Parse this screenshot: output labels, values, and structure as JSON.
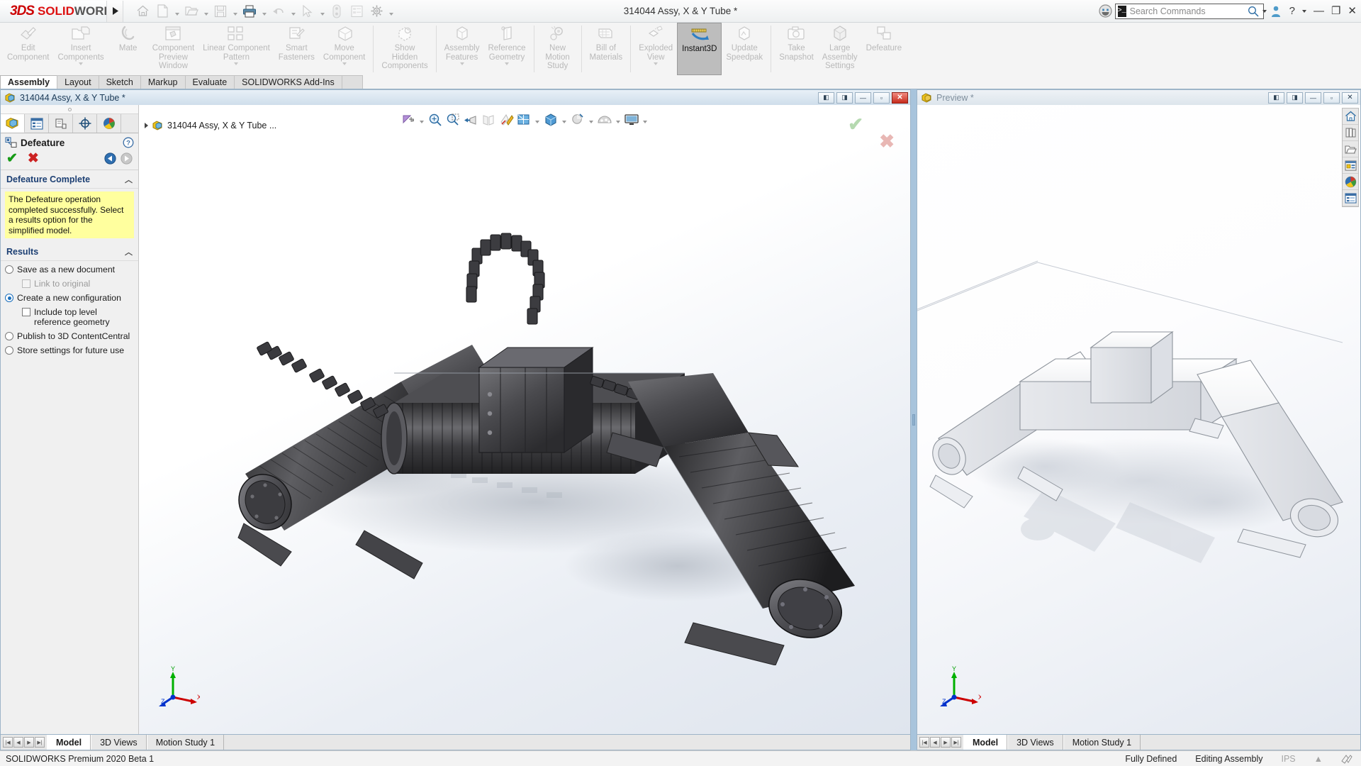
{
  "app": {
    "brand_ds": "3DS",
    "brand_solid": "SOLID",
    "brand_works": "WORKS",
    "document_title": "314044 Assy, X & Y Tube *",
    "accent_color": "#cc0000",
    "selected_tool_color": "#bdbdbd"
  },
  "quick_access": [
    {
      "name": "home-icon",
      "label": "Home"
    },
    {
      "name": "new-document-icon",
      "label": "New",
      "dropdown": true
    },
    {
      "name": "open-folder-icon",
      "label": "Open",
      "dropdown": true
    },
    {
      "name": "save-icon",
      "label": "Save",
      "dropdown": true
    },
    {
      "name": "print-icon",
      "label": "Print",
      "dropdown": true,
      "active": true
    },
    {
      "name": "undo-icon",
      "label": "Undo",
      "dropdown": true
    },
    {
      "name": "select-cursor-icon",
      "label": "Select",
      "dropdown": true
    },
    {
      "name": "rebuild-icon",
      "label": "Rebuild"
    },
    {
      "name": "file-properties-icon",
      "label": "File Properties"
    },
    {
      "name": "options-gear-icon",
      "label": "Options",
      "dropdown": true
    }
  ],
  "search": {
    "placeholder": "Search Commands",
    "prompt_glyph": ">_"
  },
  "window_controls": {
    "help": "?",
    "minimize": "—",
    "restore": "❐",
    "close": "✕"
  },
  "ribbon": {
    "commands": [
      {
        "label": "Edit\nComponent",
        "icon": "edit-component-icon",
        "enabled": false,
        "dropdown": false
      },
      {
        "label": "Insert\nComponents",
        "icon": "insert-components-icon",
        "enabled": false,
        "dropdown": true
      },
      {
        "label": "Mate",
        "icon": "mate-icon",
        "enabled": false,
        "dropdown": false
      },
      {
        "label": "Component\nPreview\nWindow",
        "icon": "component-preview-window-icon",
        "enabled": false,
        "dropdown": false
      },
      {
        "label": "Linear Component\nPattern",
        "icon": "linear-component-pattern-icon",
        "enabled": false,
        "dropdown": true
      },
      {
        "label": "Smart\nFasteners",
        "icon": "smart-fasteners-icon",
        "enabled": false,
        "dropdown": false
      },
      {
        "label": "Move\nComponent",
        "icon": "move-component-icon",
        "enabled": false,
        "dropdown": true
      },
      {
        "separator": true
      },
      {
        "label": "Show\nHidden\nComponents",
        "icon": "show-hidden-components-icon",
        "enabled": false,
        "dropdown": false
      },
      {
        "separator": true
      },
      {
        "label": "Assembly\nFeatures",
        "icon": "assembly-features-icon",
        "enabled": false,
        "dropdown": true
      },
      {
        "label": "Reference\nGeometry",
        "icon": "reference-geometry-icon",
        "enabled": false,
        "dropdown": true
      },
      {
        "separator": true
      },
      {
        "label": "New\nMotion\nStudy",
        "icon": "new-motion-study-icon",
        "enabled": false,
        "dropdown": false
      },
      {
        "separator": true
      },
      {
        "label": "Bill of\nMaterials",
        "icon": "bill-of-materials-icon",
        "enabled": false,
        "dropdown": false
      },
      {
        "separator": true
      },
      {
        "label": "Exploded\nView",
        "icon": "exploded-view-icon",
        "enabled": false,
        "dropdown": true
      },
      {
        "label": "Instant3D",
        "icon": "instant3d-icon",
        "enabled": true,
        "selected": true,
        "dropdown": false
      },
      {
        "label": "Update\nSpeedpak",
        "icon": "update-speedpak-icon",
        "enabled": false,
        "dropdown": false
      },
      {
        "separator": true
      },
      {
        "label": "Take\nSnapshot",
        "icon": "take-snapshot-icon",
        "enabled": false,
        "dropdown": false
      },
      {
        "label": "Large\nAssembly\nSettings",
        "icon": "large-assembly-settings-icon",
        "enabled": false,
        "dropdown": false
      },
      {
        "label": "Defeature",
        "icon": "defeature-icon",
        "enabled": false,
        "dropdown": false
      }
    ],
    "tabs": [
      {
        "label": "Assembly",
        "active": true
      },
      {
        "label": "Layout",
        "active": false
      },
      {
        "label": "Sketch",
        "active": false
      },
      {
        "label": "Markup",
        "active": false
      },
      {
        "label": "Evaluate",
        "active": false
      },
      {
        "label": "SOLIDWORKS Add-Ins",
        "active": false
      }
    ]
  },
  "main_window": {
    "title": "314044 Assy, X & Y Tube *",
    "controls": [
      "split-left",
      "split-right",
      "minimize",
      "restore",
      "close"
    ],
    "feature_tree_root": "314044 Assy, X & Y Tube  ...",
    "property_manager": {
      "tabs": [
        {
          "name": "feature-manager-tab",
          "active": true
        },
        {
          "name": "property-manager-tab",
          "active": false
        },
        {
          "name": "configuration-manager-tab",
          "active": false
        },
        {
          "name": "dimxpert-manager-tab",
          "active": false
        },
        {
          "name": "display-manager-tab",
          "active": false
        }
      ],
      "title": "Defeature",
      "help_label": "?",
      "accept_label": "✔",
      "cancel_label": "✖",
      "sections": [
        {
          "header": "Defeature Complete",
          "message": "The Defeature operation completed successfully. Select a results option for the simplified model."
        }
      ],
      "results": {
        "header": "Results",
        "options": [
          {
            "type": "radio",
            "label": "Save as a new document",
            "checked": false,
            "indent": false,
            "dim": false
          },
          {
            "type": "checkbox",
            "label": "Link to original",
            "checked": false,
            "indent": true,
            "dim": true
          },
          {
            "type": "radio",
            "label": "Create a new configuration",
            "checked": true,
            "indent": false,
            "dim": false
          },
          {
            "type": "checkbox",
            "label": "Include top level reference geometry",
            "checked": false,
            "indent": true,
            "dim": false
          },
          {
            "type": "radio",
            "label": "Publish to 3D ContentCentral",
            "checked": false,
            "indent": false,
            "dim": false
          },
          {
            "type": "radio",
            "label": "Store settings for future use",
            "checked": false,
            "indent": false,
            "dim": false
          }
        ]
      }
    },
    "view_toolbar": [
      {
        "name": "zoom-to-fit-icon",
        "dropdown": true
      },
      {
        "name": "zoom-to-area-icon",
        "dropdown": false
      },
      {
        "name": "previous-view-icon",
        "dropdown": false
      },
      {
        "name": "section-view-icon",
        "dropdown": false
      },
      {
        "name": "view-orientation-icon",
        "dropdown": false
      },
      {
        "name": "display-style-icon",
        "dropdown": true
      },
      {
        "name": "hide-show-items-icon",
        "dropdown": true
      },
      {
        "name": "edit-appearance-icon",
        "dropdown": false
      },
      {
        "name": "apply-scene-icon",
        "dropdown": true
      },
      {
        "name": "view-settings-icon",
        "dropdown": true
      }
    ],
    "triad": {
      "x": "X",
      "y": "Y",
      "z": "Z"
    },
    "bottom_tabs": [
      {
        "label": "Model",
        "active": true
      },
      {
        "label": "3D Views",
        "active": false
      },
      {
        "label": "Motion Study 1",
        "active": false
      }
    ]
  },
  "preview_window": {
    "title": "Preview *",
    "controls": [
      "split-left",
      "split-right",
      "minimize",
      "restore",
      "close"
    ],
    "side_toolbar": [
      {
        "name": "home-view-icon"
      },
      {
        "name": "appearances-library-icon"
      },
      {
        "name": "design-library-folder-icon"
      },
      {
        "name": "file-explorer-icon"
      },
      {
        "name": "appearances-sphere-icon"
      },
      {
        "name": "custom-properties-icon"
      }
    ],
    "triad": {
      "x": "X",
      "y": "Y",
      "z": "Z"
    },
    "bottom_tabs": [
      {
        "label": "Model",
        "active": true
      },
      {
        "label": "3D Views",
        "active": false
      },
      {
        "label": "Motion Study 1",
        "active": false
      }
    ]
  },
  "status_bar": {
    "left": "SOLIDWORKS Premium 2020 Beta 1",
    "sketch_state": "Fully Defined",
    "mode": "Editing Assembly",
    "units": "IPS",
    "units_caret": "▲"
  }
}
